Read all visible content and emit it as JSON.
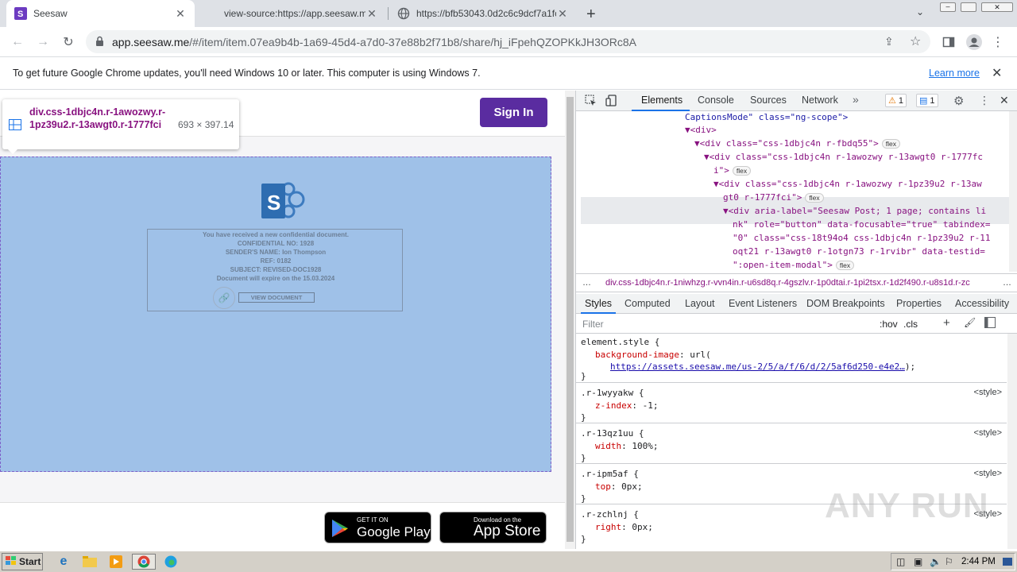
{
  "tabs": [
    {
      "title": "Seesaw",
      "active": true
    },
    {
      "title": "view-source:https://app.seesaw.me",
      "active": false
    },
    {
      "title": "https://bfb53043.0d2c6c9dcf7a1fc",
      "active": false
    }
  ],
  "toolbar": {
    "url_host": "app.seesaw.me",
    "url_path": "/#/item/item.07ea9b4b-1a69-45d4-a7d0-37e88b2f71b8/share/hj_iFpehQZOPKkJH3ORc8A"
  },
  "infobar": {
    "message": "To get future Google Chrome updates, you'll need Windows 10 or later. This computer is using Windows 7.",
    "learn_more": "Learn more"
  },
  "page": {
    "signin_label": "Sign In",
    "tooltip_selector": "div.css-1dbjc4n.r-1awozwy.r-1pz39u2.r-13awgt0.r-1777fci",
    "tooltip_size": "693 × 397.14",
    "doc_lines": [
      "You have received a new confidential document.",
      "CONFIDENTIAL NO: 1928",
      "SENDER'S NAME: Ion Thompson",
      "REF: 0182",
      "SUBJECT: REVISED-DOC1928",
      "Document will expire on the 15.03.2024"
    ],
    "view_document": "VIEW DOCUMENT",
    "google_play_small": "GET IT ON",
    "google_play_big": "Google Play",
    "app_store_small": "Download on the",
    "app_store_big": "App Store"
  },
  "devtools": {
    "tabs": [
      "Elements",
      "Console",
      "Sources",
      "Network"
    ],
    "warnings": "1",
    "messages": "1",
    "dom_lines": [
      {
        "indent": 0,
        "text": "CaptionsMode\" class=\"ng-scope\">"
      },
      {
        "indent": 1,
        "text": "▼<div>"
      },
      {
        "indent": 2,
        "text": "▼<div class=\"css-1dbjc4n r-fbdq55\">"
      },
      {
        "indent": 3,
        "text": "▼<div class=\"css-1dbjc4n r-1awozwy r-13awgt0 r-1777fc"
      },
      {
        "indent": 4,
        "text": "i\">"
      },
      {
        "indent": 4,
        "text": "▼<div class=\"css-1dbjc4n r-1awozwy r-1pz39u2 r-13aw"
      },
      {
        "indent": 5,
        "text": "gt0 r-1777fci\">"
      },
      {
        "indent": 5,
        "text": "▼<div aria-label=\"Seesaw Post; 1 page; contains li"
      },
      {
        "indent": 6,
        "text": "nk\" role=\"button\" data-focusable=\"true\" tabindex="
      },
      {
        "indent": 6,
        "text": "\"0\" class=\"css-18t94o4 css-1dbjc4n r-1pz39u2 r-11"
      },
      {
        "indent": 6,
        "text": "oqt21 r-13awgt0 r-1otgn73 r-1rvibr\" data-testid="
      },
      {
        "indent": 6,
        "text": "\":open-item-modal\">"
      }
    ],
    "flex_badge": "flex",
    "breadcrumb": "div.css-1dbjc4n.r-1niwhzg.r-vvn4in.r-u6sd8q.r-4gszlv.r-1p0dtai.r-1pi2tsx.r-1d2f490.r-u8s1d.r-zc",
    "styles_tabs": [
      "Styles",
      "Computed",
      "Layout",
      "Event Listeners",
      "DOM Breakpoints",
      "Properties",
      "Accessibility"
    ],
    "filter_placeholder": "Filter",
    "hov": ":hov",
    "cls": ".cls",
    "rules": [
      {
        "selector": "element.style {",
        "prop": "background-image",
        "value": "url(",
        "link": "https://assets.seesaw.me/us-2/5/a/f/6/d/2/5af6d250-e4e2…",
        "tail": ");",
        "source": ""
      },
      {
        "selector": ".r-1wyyakw {",
        "prop": "z-index",
        "value": "-1;",
        "source": "<style>"
      },
      {
        "selector": ".r-13qz1uu {",
        "prop": "width",
        "value": "100%;",
        "source": "<style>"
      },
      {
        "selector": ".r-ipm5af {",
        "prop": "top",
        "value": "0px;",
        "source": "<style>"
      },
      {
        "selector": ".r-zchlnj {",
        "prop": "right",
        "value": "0px;",
        "source": "<style>"
      }
    ]
  },
  "taskbar": {
    "start": "Start",
    "clock": "2:44 PM"
  },
  "watermark": "ANY RUN"
}
